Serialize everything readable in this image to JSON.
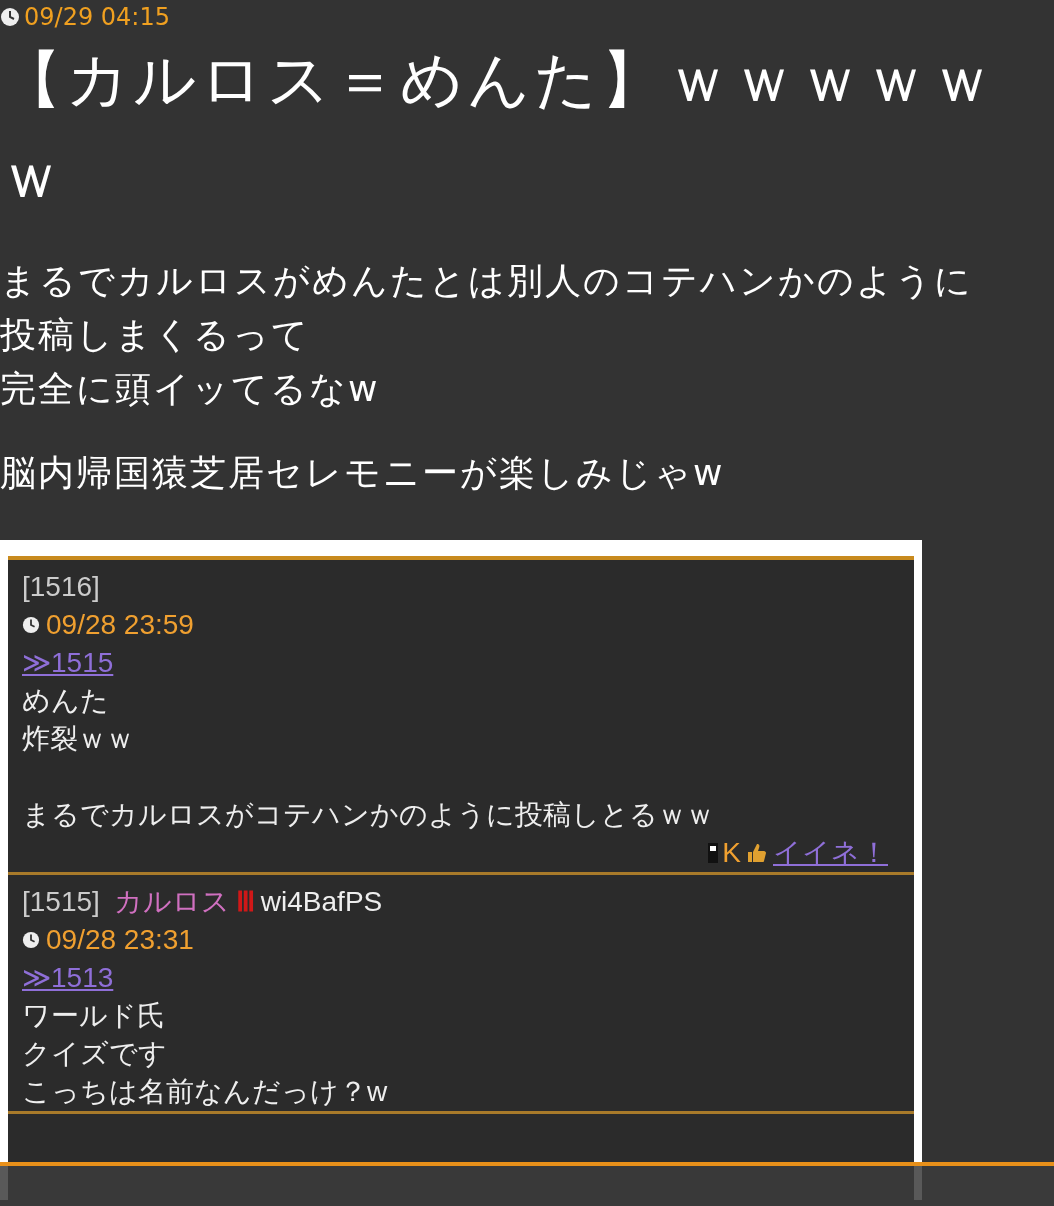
{
  "post": {
    "date": "09/29 04:15",
    "title": "【カルロス＝めんた】ｗｗｗｗｗｗ",
    "paragraphs": [
      [
        "まるでカルロスがめんたとは別人のコテハンかのように投稿しまくるって",
        "完全に頭イッてるなw"
      ],
      [
        "脳内帰国猿芝居セレモニーが楽しみじゃw"
      ]
    ]
  },
  "screenshot": {
    "posts": [
      {
        "number": "[1516]",
        "date": "09/28 23:59",
        "reply": "≫1515",
        "paragraphs": [
          [
            "めんた",
            "炸裂ｗｗ"
          ],
          [
            "まるでカルロスがコテハンかのように投稿しとるｗｗ"
          ]
        ],
        "like": {
          "mark": "K",
          "link": "イイネ！"
        }
      },
      {
        "number": "[1515]",
        "name": "カルロス",
        "rank": "Ⅲ",
        "trip": "wi4BafPS",
        "date": "09/28 23:31",
        "reply": "≫1513",
        "paragraphs": [
          [
            "ワールド氏",
            "クイズです",
            "こっちは名前なんだっけ？w"
          ]
        ]
      }
    ]
  }
}
